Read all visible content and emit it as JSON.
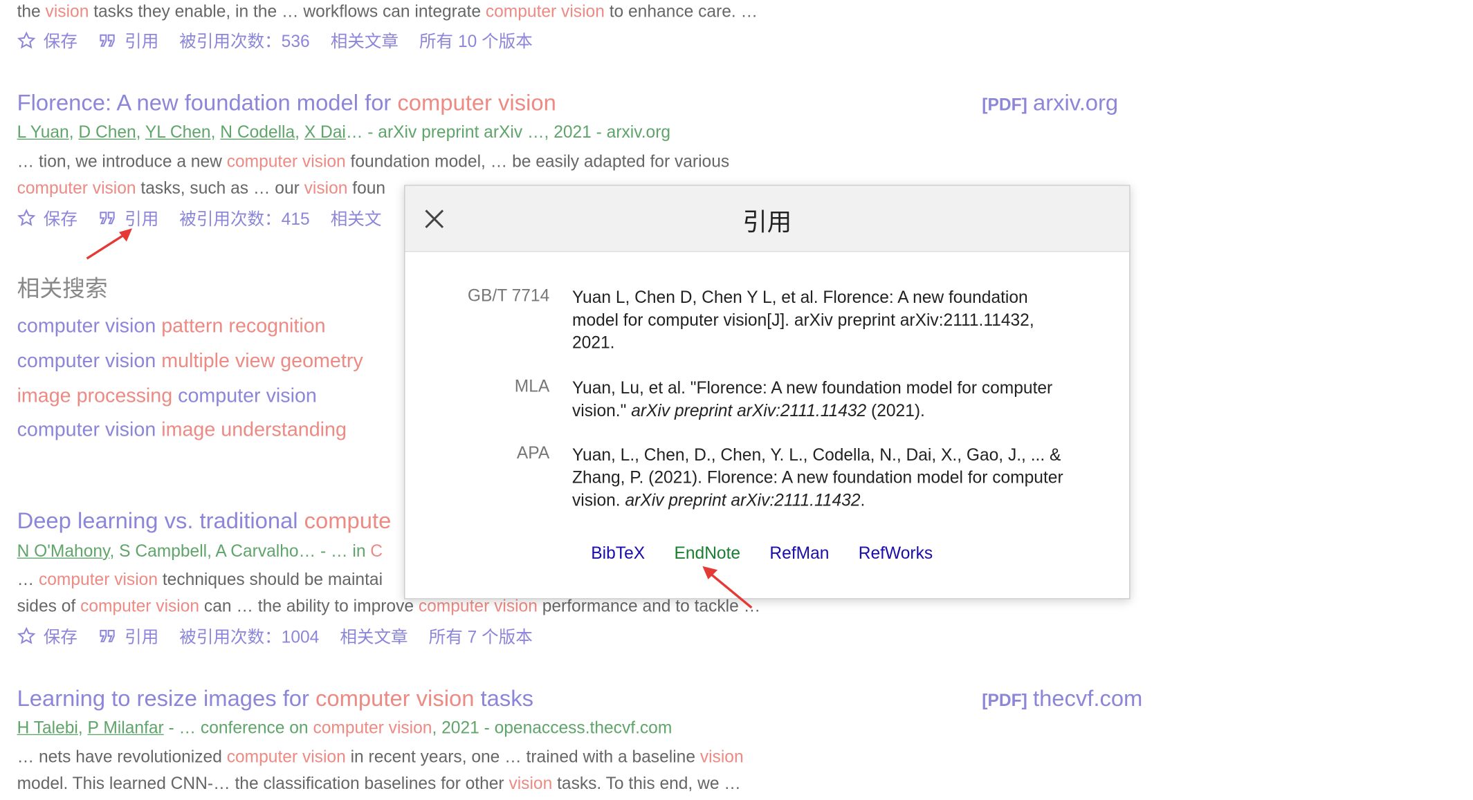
{
  "top_snippet": {
    "parts": [
      "the ",
      "vision",
      " tasks they enable, in the … workflows can integrate ",
      "computer vision",
      " to enhance care. …"
    ]
  },
  "result0_actions": {
    "save": "保存",
    "cite": "引用",
    "cited_by": "被引用次数：536",
    "related": "相关文章",
    "versions": "所有 10 个版本"
  },
  "result1": {
    "title_a": "Florence: A new foundation model for ",
    "title_b": "computer vision",
    "pdf_tag": "[PDF]",
    "pdf_source": "arxiv.org",
    "authors": [
      "L Yuan",
      "D Chen",
      "YL Chen",
      "N Codella",
      "X Dai"
    ],
    "authors_tail": "… - arXiv preprint arXiv …, 2021 - arxiv.org",
    "snip1_a": "… tion, we introduce a new ",
    "snip1_b": "computer vision",
    "snip1_c": " foundation model, … be easily adapted for various",
    "snip2_a": "computer vision",
    "snip2_b": " tasks, such as … our ",
    "snip2_c": "vision",
    "snip2_d": " foun",
    "save": "保存",
    "cite": "引用",
    "cited_by": "被引用次数：415",
    "related": "相关文"
  },
  "related_searches": {
    "heading": "相关搜索",
    "items": [
      {
        "a": "computer vision ",
        "b": "pattern recognition"
      },
      {
        "a": "computer vision ",
        "b": "multiple view geometry"
      },
      {
        "b0": "image processing ",
        "a0": "computer vision"
      },
      {
        "a": "computer vision ",
        "b": "image understanding"
      }
    ]
  },
  "result2": {
    "title_a": "Deep learning vs. traditional ",
    "title_b": "compute",
    "authors": [
      "N O'Mahony"
    ],
    "authors_tail": ", S Campbell, A Carvalho… - … in ",
    "authors_tail_c": "C",
    "snip1_a": "… ",
    "snip1_b": "computer vision",
    "snip1_c": " techniques should be maintai",
    "snip2_a": "sides of ",
    "snip2_b": "computer vision",
    "snip2_c": " can … the ability to improve ",
    "snip2_d": "computer vision",
    "snip2_e": " performance and to tackle …",
    "save": "保存",
    "cite": "引用",
    "cited_by": "被引用次数：1004",
    "related": "相关文章",
    "versions": "所有 7 个版本"
  },
  "result3": {
    "title_a": "Learning to resize images for ",
    "title_b": "computer vision",
    "title_c": " tasks",
    "pdf_tag": "[PDF]",
    "pdf_source": "thecvf.com",
    "authors": [
      "H Talebi",
      "P Milanfar"
    ],
    "authors_tail_a": " - … conference on ",
    "authors_tail_b": "computer vision",
    "authors_tail_c": ", 2021 - openaccess.thecvf.com",
    "snip1_a": "… nets have revolutionized ",
    "snip1_b": "computer vision",
    "snip1_c": " in recent years, one … trained with a baseline ",
    "snip1_d": "vision",
    "snip2_a": "model. This learned CNN-… the classification baselines for other ",
    "snip2_b": "vision",
    "snip2_c": " tasks. To this end, we …"
  },
  "modal": {
    "title": "引用",
    "close_icon": "close-icon",
    "citations": [
      {
        "style": "GB/T 7714",
        "text": "Yuan L, Chen D, Chen Y L, et al. Florence: A new foundation model for computer vision[J]. arXiv preprint arXiv:2111.11432, 2021."
      },
      {
        "style": "MLA",
        "text_a": "Yuan, Lu, et al. \"Florence: A new foundation model for computer vision.\" ",
        "text_i": "arXiv preprint arXiv:2111.11432",
        "text_b": " (2021)."
      },
      {
        "style": "APA",
        "text_a": "Yuan, L., Chen, D., Chen, Y. L., Codella, N., Dai, X., Gao, J., ... & Zhang, P. (2021). Florence: A new foundation model for computer vision. ",
        "text_i": "arXiv preprint arXiv:2111.11432",
        "text_b": "."
      }
    ],
    "exports": [
      "BibTeX",
      "EndNote",
      "RefMan",
      "RefWorks"
    ]
  },
  "colors": {
    "link": "#8c86d9",
    "highlight": "#ec8a83",
    "green": "#5fa56a",
    "export_link": "#1a0dab",
    "arrow": "#e53935"
  }
}
